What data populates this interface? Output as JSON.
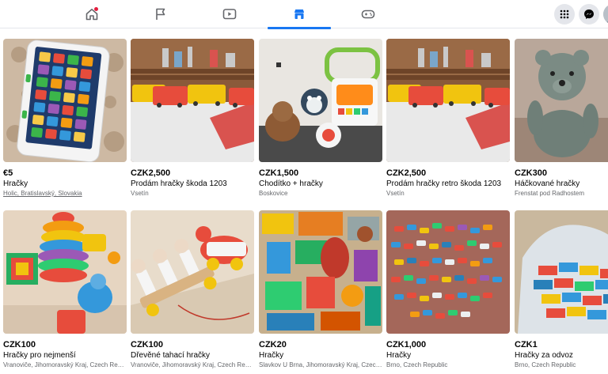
{
  "nav": {
    "tabs": [
      {
        "name": "home",
        "icon": "home-icon"
      },
      {
        "name": "pages",
        "icon": "flag-icon"
      },
      {
        "name": "watch",
        "icon": "video-icon"
      },
      {
        "name": "marketplace",
        "icon": "marketplace-icon",
        "active": true
      },
      {
        "name": "gaming",
        "icon": "gaming-icon"
      }
    ],
    "right_buttons": [
      "menu-grid-icon",
      "messenger-icon",
      "profile-avatar"
    ],
    "accent": "#1877f2",
    "notification_color": "#e41e3f"
  },
  "listings": [
    {
      "price": "€5",
      "title": "Hračky",
      "location": "Holic, Bratislavský, Slovakia",
      "image": "tablet toy"
    },
    {
      "price": "CZK2,500",
      "title": "Prodám hračky škoda 1203",
      "location": "Vsetín",
      "image": "toy vans on shelf"
    },
    {
      "price": "CZK1,500",
      "title": "Chodítko + hračky",
      "location": "Boskovice",
      "image": "baby walker and plush toys"
    },
    {
      "price": "CZK2,500",
      "title": "Prodám hračky retro škoda 1203",
      "location": "Vsetín",
      "image": "toy vans on shelf"
    },
    {
      "price": "CZK300",
      "title": "Háčkované hračky",
      "location": "Frenstat pod Radhostem",
      "image": "crochet teddy"
    },
    {
      "price": "CZK100",
      "title": "Hračky pro nejmenší",
      "location": "Vranoviče, Jihomoravský Kraj, Czech Repu...",
      "image": "stacking toys"
    },
    {
      "price": "CZK100",
      "title": "Dřevěné tahací hračky",
      "location": "Vranoviče, Jihomoravský Kraj, Czech Repu...",
      "image": "wooden pull toys"
    },
    {
      "price": "CZK20",
      "title": "Hračky",
      "location": "Slavkov U Brna, Jihomoravský Kraj, Czech ...",
      "image": "pile of toys"
    },
    {
      "price": "CZK1,000",
      "title": "Hračky",
      "location": "Brno, Czech Republic",
      "image": "toy cars collection"
    },
    {
      "price": "CZK1",
      "title": "Hračky za odvoz",
      "location": "Brno, Czech Republic",
      "image": "bag of building blocks"
    }
  ]
}
